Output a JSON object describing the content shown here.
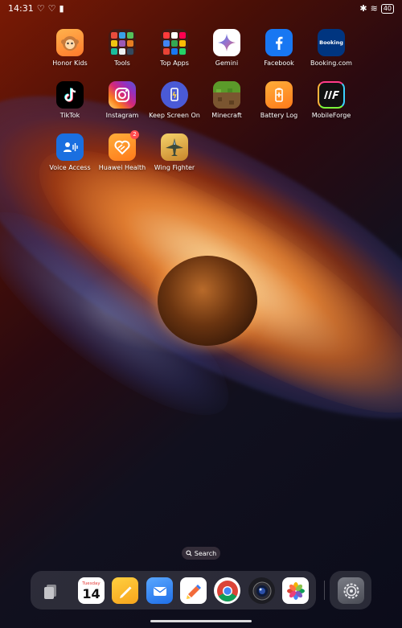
{
  "status_bar": {
    "time": "14:31",
    "battery": "40"
  },
  "apps": [
    {
      "label": "Honor Kids",
      "icon": "honor-kids-icon",
      "color": "#ff9d3b"
    },
    {
      "label": "Tools",
      "icon": "tools-folder-icon",
      "color": "#3c1e19"
    },
    {
      "label": "Top Apps",
      "icon": "top-apps-folder-icon",
      "color": "#3c1e19"
    },
    {
      "label": "Gemini",
      "icon": "gemini-icon",
      "color": "#ffffff"
    },
    {
      "label": "Facebook",
      "icon": "facebook-icon",
      "color": "#1877f2"
    },
    {
      "label": "Booking.com",
      "icon": "booking-icon",
      "color": "#003580"
    },
    {
      "label": "TikTok",
      "icon": "tiktok-icon",
      "color": "#000000"
    },
    {
      "label": "Instagram",
      "icon": "instagram-icon",
      "color": "#e1306c"
    },
    {
      "label": "Keep Screen On",
      "icon": "keep-screen-on-icon",
      "color": "#4a5ad6"
    },
    {
      "label": "Minecraft",
      "icon": "minecraft-icon",
      "color": "#6b8e23"
    },
    {
      "label": "Battery Log",
      "icon": "battery-log-icon",
      "color": "#ff8a1f"
    },
    {
      "label": "MobileForge",
      "icon": "mobileforge-icon",
      "color": "#1a1a1a"
    },
    {
      "label": "Voice Access",
      "icon": "voice-access-icon",
      "color": "#1a6fe0"
    },
    {
      "label": "Huawei Health",
      "icon": "huawei-health-icon",
      "color": "#ff8a1f",
      "badge": "2"
    },
    {
      "label": "Wing Fighter",
      "icon": "wing-fighter-icon",
      "color": "#e8b24a"
    }
  ],
  "app_icon_text": {
    "booking": "Booking"
  },
  "search": {
    "label": "Search"
  },
  "dock": {
    "calendar_day": "Tuesday",
    "calendar_date": "14",
    "apps": [
      {
        "icon": "recent-apps-icon"
      },
      {
        "icon": "calendar-icon"
      },
      {
        "icon": "notes-icon"
      },
      {
        "icon": "mail-icon"
      },
      {
        "icon": "themes-icon"
      },
      {
        "icon": "chrome-icon"
      },
      {
        "icon": "camera-icon"
      },
      {
        "icon": "photos-icon"
      },
      {
        "icon": "settings-icon"
      }
    ]
  }
}
